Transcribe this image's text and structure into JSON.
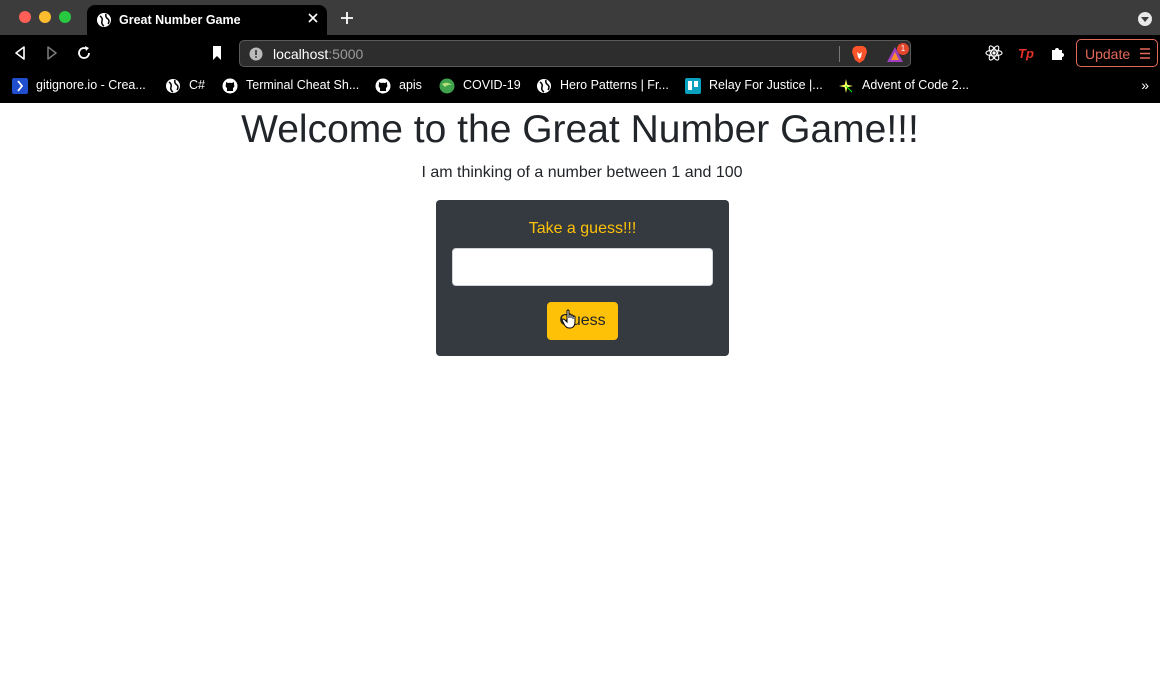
{
  "browser": {
    "tab": {
      "title": "Great Number Game",
      "favicon": "globe-icon"
    },
    "address": {
      "host": "localhost",
      "port": ":5000"
    },
    "rewards_badge": "1",
    "update_label": "Update",
    "bookmarks": [
      {
        "label": "gitignore.io - Crea...",
        "icon": "gitignore-icon"
      },
      {
        "label": "C#",
        "icon": "globe-icon"
      },
      {
        "label": "Terminal Cheat Sh...",
        "icon": "github-icon"
      },
      {
        "label": "apis",
        "icon": "github-icon"
      },
      {
        "label": "COVID-19",
        "icon": "covid-icon"
      },
      {
        "label": "Hero Patterns | Fr...",
        "icon": "globe-icon"
      },
      {
        "label": "Relay For Justice |...",
        "icon": "trello-icon"
      },
      {
        "label": "Advent of Code 2...",
        "icon": "star-icon"
      }
    ],
    "bookmarks_overflow": "»"
  },
  "page": {
    "heading": "Welcome to the Great Number Game!!!",
    "subtitle": "I am thinking of a number between 1 and 100",
    "form": {
      "prompt": "Take a guess!!!",
      "guess_value": "",
      "button_label": "Guess"
    }
  },
  "colors": {
    "accent": "#ffc107",
    "card_bg": "#343a40",
    "text": "#212529",
    "update": "#e5695a"
  }
}
